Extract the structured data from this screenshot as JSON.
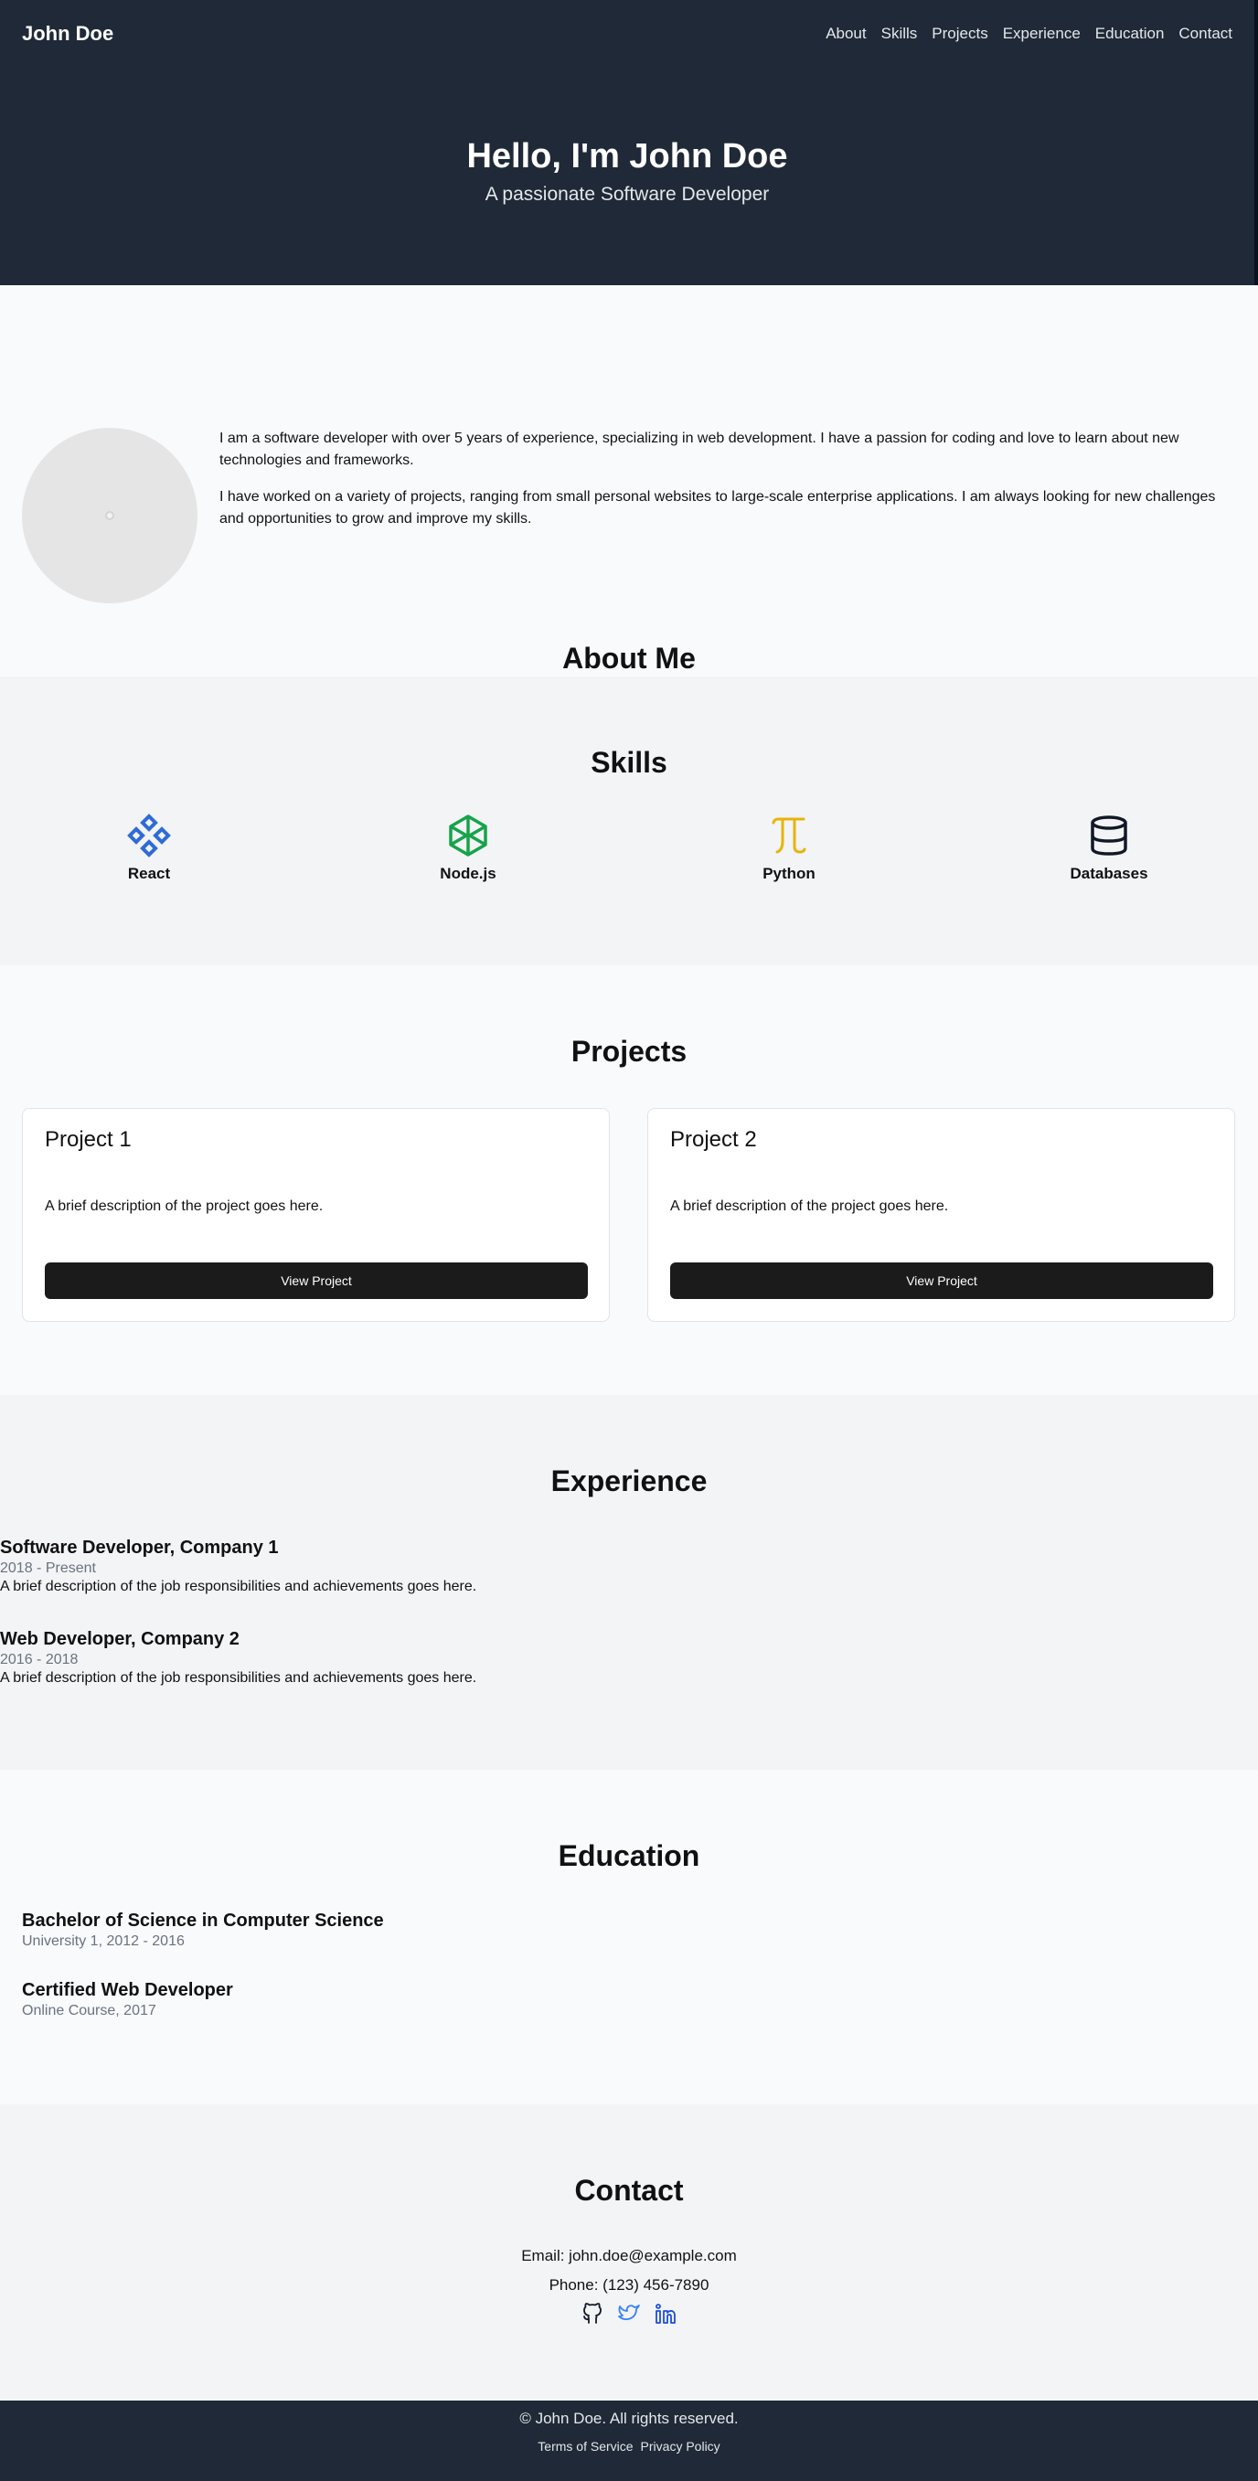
{
  "header": {
    "brand": "John Doe",
    "nav": [
      "About",
      "Skills",
      "Projects",
      "Experience",
      "Education",
      "Contact"
    ],
    "hero_title": "Hello, I'm John Doe",
    "hero_subtitle": "A passionate Software Developer"
  },
  "about": {
    "title": "About Me",
    "paragraphs": [
      "I am a software developer with over 5 years of experience, specializing in web development. I have a passion for coding and love to learn about new technologies and frameworks.",
      "I have worked on a variety of projects, ranging from small personal websites to large-scale enterprise applications. I am always looking for new challenges and opportunities to grow and improve my skills."
    ]
  },
  "skills": {
    "title": "Skills",
    "items": [
      {
        "label": "React",
        "icon": "react-icon",
        "color": "#2f6bd6"
      },
      {
        "label": "Node.js",
        "icon": "nodejs-icon",
        "color": "#16a34a"
      },
      {
        "label": "Python",
        "icon": "python-icon",
        "color": "#eab308"
      },
      {
        "label": "Databases",
        "icon": "database-icon",
        "color": "#111827"
      }
    ]
  },
  "projects": {
    "title": "Projects",
    "items": [
      {
        "title": "Project 1",
        "description": "A brief description of the project goes here.",
        "button": "View Project"
      },
      {
        "title": "Project 2",
        "description": "A brief description of the project goes here.",
        "button": "View Project"
      }
    ]
  },
  "experience": {
    "title": "Experience",
    "jobs": [
      {
        "title": "Software Developer, Company 1",
        "dates": "2018 - Present",
        "description": "A brief description of the job responsibilities and achievements goes here."
      },
      {
        "title": "Web Developer, Company 2",
        "dates": "2016 - 2018",
        "description": "A brief description of the job responsibilities and achievements goes here."
      }
    ]
  },
  "education": {
    "title": "Education",
    "items": [
      {
        "title": "Bachelor of Science in Computer Science",
        "sub": "University 1, 2012 - 2016"
      },
      {
        "title": "Certified Web Developer",
        "sub": "Online Course, 2017"
      }
    ]
  },
  "contact": {
    "title": "Contact",
    "email": "Email: john.doe@example.com",
    "phone": "Phone: (123) 456-7890",
    "socials": [
      {
        "icon": "github-icon",
        "color": "#111827"
      },
      {
        "icon": "twitter-icon",
        "color": "#3b82f6"
      },
      {
        "icon": "linkedin-icon",
        "color": "#1d4ed8"
      }
    ]
  },
  "footer": {
    "copyright": "© John Doe. All rights reserved.",
    "links": [
      "Terms of Service",
      "Privacy Policy"
    ]
  }
}
